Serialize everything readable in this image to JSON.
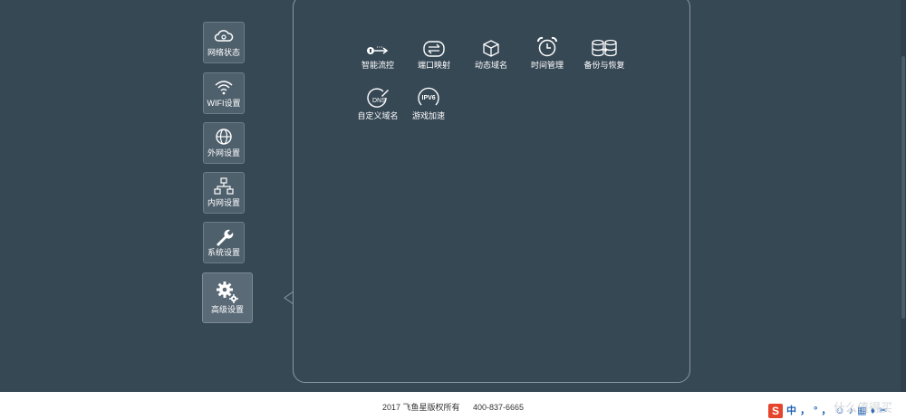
{
  "sidebar": {
    "items": [
      {
        "label": "网络状态",
        "icon": "cloud-icon"
      },
      {
        "label": "WIFI设置",
        "icon": "wifi-icon"
      },
      {
        "label": "外网设置",
        "icon": "globe-icon"
      },
      {
        "label": "内网设置",
        "icon": "lan-icon"
      },
      {
        "label": "系统设置",
        "icon": "wrench-icon"
      },
      {
        "label": "高级设置",
        "icon": "gears-icon",
        "active": true
      }
    ]
  },
  "tools": [
    {
      "label": "智能流控",
      "icon": "flow-control-icon"
    },
    {
      "label": "端口映射",
      "icon": "port-mapping-icon"
    },
    {
      "label": "动态域名",
      "icon": "cube-icon"
    },
    {
      "label": "时间管理",
      "icon": "alarm-clock-icon"
    },
    {
      "label": "备份与恢复",
      "icon": "database-backup-icon"
    },
    {
      "label": "自定义域名",
      "icon": "dns-icon"
    },
    {
      "label": "游戏加速",
      "icon": "ipv6-icon"
    }
  ],
  "footer": {
    "copyright": "2017 飞鱼星版权所有",
    "phone": "400-837-6665"
  },
  "ime": {
    "logo": "S",
    "chars": [
      "中",
      "，",
      "°",
      "，",
      "☺",
      "♪",
      "▦",
      "♦",
      "✂"
    ]
  },
  "watermark": "什么值得买",
  "colors": {
    "background": "#374855",
    "button": "#4f606d",
    "border": "#8897a2",
    "ime_red": "#e6452d"
  }
}
